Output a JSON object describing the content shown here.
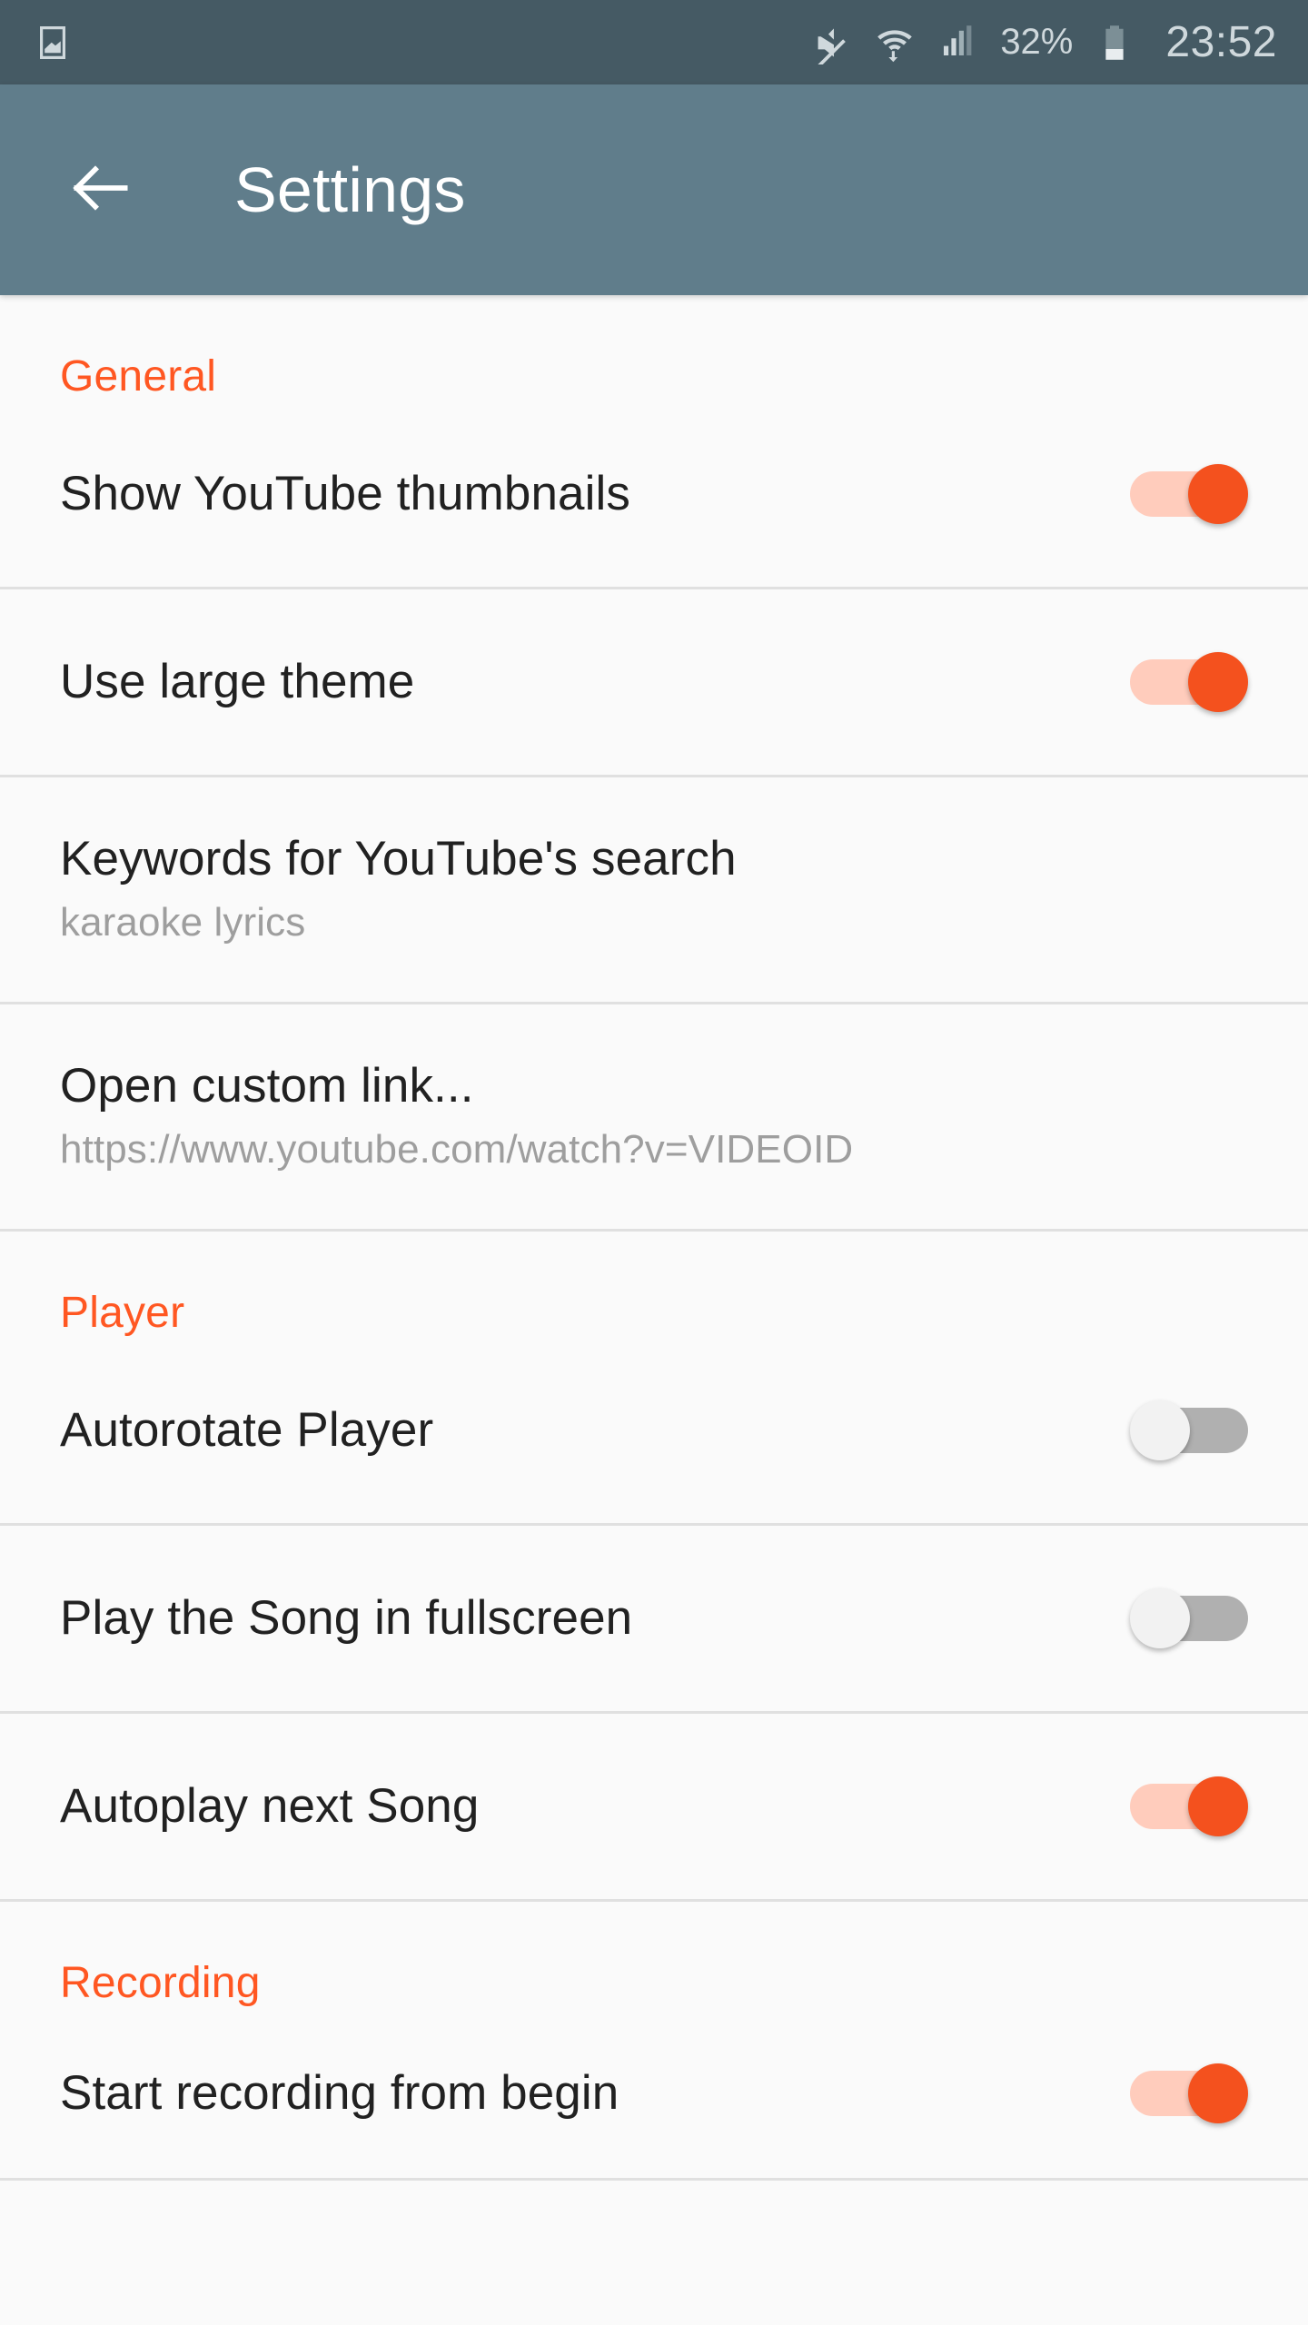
{
  "status_bar": {
    "notification_icon": "image-notification-icon",
    "mute_icon": "volume-mute-icon",
    "wifi_icon": "wifi-icon",
    "signal_icon": "cellular-signal-icon",
    "battery_percent": "32%",
    "battery_icon": "battery-icon",
    "time": "23:52",
    "background_color": "#455A64",
    "foreground_color": "#CFD8DC"
  },
  "app_bar": {
    "back_icon": "back-arrow-icon",
    "title": "Settings",
    "background_color": "#607D8B",
    "title_color": "#FFFFFF"
  },
  "theme": {
    "accent_color": "#FF5722",
    "toggle_on_thumb": "#F4511E",
    "toggle_on_track": "#FFCCBC",
    "toggle_off_thumb": "#F2F2F2",
    "toggle_off_track": "#B0B0B0",
    "page_background": "#FAFAFA",
    "divider_color": "#E0E0E0"
  },
  "sections": [
    {
      "header": "General",
      "rows": [
        {
          "title": "Show YouTube thumbnails",
          "subtitle": "",
          "control": "toggle",
          "state": "on"
        },
        {
          "title": "Use large theme",
          "subtitle": "",
          "control": "toggle",
          "state": "on"
        },
        {
          "title": "Keywords for YouTube's search",
          "subtitle": "karaoke lyrics",
          "control": "none",
          "state": ""
        },
        {
          "title": "Open custom link...",
          "subtitle": "https://www.youtube.com/watch?v=VIDEOID",
          "control": "none",
          "state": ""
        }
      ]
    },
    {
      "header": "Player",
      "rows": [
        {
          "title": "Autorotate Player",
          "subtitle": "",
          "control": "toggle",
          "state": "off"
        },
        {
          "title": "Play the Song in fullscreen",
          "subtitle": "",
          "control": "toggle",
          "state": "off"
        },
        {
          "title": "Autoplay next Song",
          "subtitle": "",
          "control": "toggle",
          "state": "on"
        }
      ]
    },
    {
      "header": "Recording",
      "rows": [
        {
          "title": "Start recording from begin",
          "subtitle": "",
          "control": "toggle",
          "state": "on"
        }
      ]
    }
  ]
}
